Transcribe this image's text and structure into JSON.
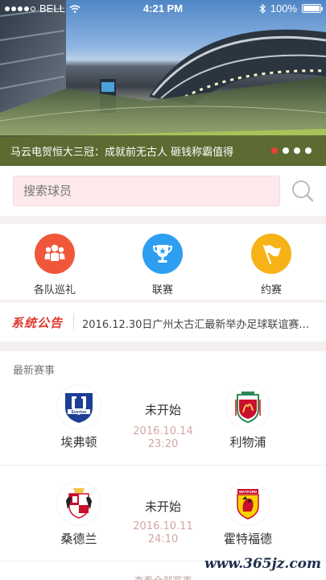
{
  "status_bar": {
    "carrier": "BELL",
    "time": "4:21 PM",
    "battery": "100%"
  },
  "banner": {
    "caption": "马云电贺恒大三冠：成就前无古人 砸钱称霸值得",
    "page_count": 4,
    "active_page": 1
  },
  "search": {
    "placeholder": "搜索球员",
    "icon": "search-icon"
  },
  "quick_links": [
    {
      "label": "各队巡礼",
      "icon": "team-people-icon",
      "color": "#f0573a"
    },
    {
      "label": "联赛",
      "icon": "trophy-icon",
      "color": "#2e9ff0"
    },
    {
      "label": "约赛",
      "icon": "flag-icon",
      "color": "#f7b217"
    }
  ],
  "notice": {
    "logo": "系统公告",
    "text": "2016.12.30日广州太古汇最新举办足球联谊赛..."
  },
  "matches": {
    "title": "最新赛事",
    "items": [
      {
        "home": "埃弗顿",
        "away": "利物浦",
        "status": "未开始",
        "date": "2016.10.14",
        "time": "23:20",
        "home_crest": "everton-crest-icon",
        "away_crest": "liverpool-crest-icon"
      },
      {
        "home": "桑德兰",
        "away": "霍特福德",
        "status": "未开始",
        "date": "2016.10.11",
        "time": "24:10",
        "home_crest": "sunderland-crest-icon",
        "away_crest": "watford-crest-icon"
      }
    ],
    "more_label": "查看全部赛事"
  },
  "watermark": "www.365jz.com",
  "colors": {
    "accent": "#e8413c",
    "date_text": "#d3a5a5"
  }
}
